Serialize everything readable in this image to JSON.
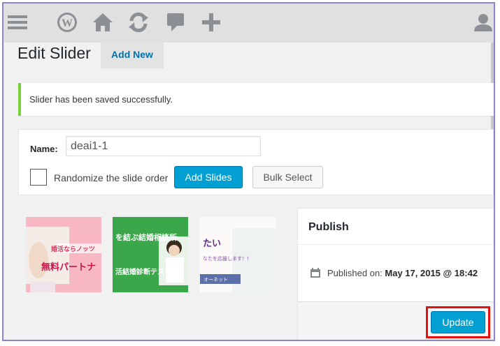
{
  "admin_bar": {
    "icons": [
      "menu-icon",
      "wordpress-logo-icon",
      "home-icon",
      "refresh-icon",
      "comment-icon",
      "plus-icon",
      "user-icon"
    ]
  },
  "page": {
    "title": "Edit Slider",
    "add_new_label": "Add New"
  },
  "notice": {
    "message": "Slider has been saved successfully."
  },
  "slider_form": {
    "name_label": "Name:",
    "name_value": "deai1-1",
    "randomize_label": "Randomize the slide order",
    "randomize_checked": false,
    "add_slides_label": "Add Slides",
    "bulk_select_label": "Bulk Select"
  },
  "slides": [
    {
      "line1": "婚活ならノッツ",
      "line2": "無料パートナ"
    },
    {
      "line1": "を結ぶ結婚相談所",
      "line2": "活結婚診断テスト"
    },
    {
      "line1": "たい",
      "line2": "なたを応援します！！",
      "line3": "オーネット"
    }
  ],
  "publish": {
    "title": "Publish",
    "published_on_label": "Published on:",
    "published_on_value": "May 17, 2015 @ 18:42",
    "update_label": "Update"
  },
  "colors": {
    "primary": "#00a0d2",
    "success_border": "#7ad03a",
    "highlight": "#e0120f",
    "link": "#0073aa"
  }
}
